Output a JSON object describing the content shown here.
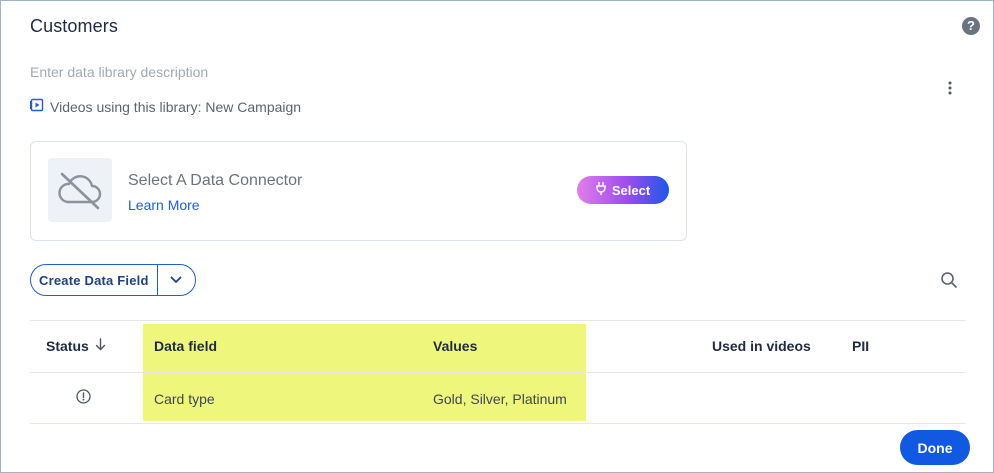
{
  "title": "Customers",
  "description_placeholder": "Enter data library description",
  "videos_text": "Videos using this library: New Campaign",
  "connector": {
    "title": "Select A Data Connector",
    "learn_more": "Learn More",
    "select_label": "Select"
  },
  "create_field_label": "Create Data Field",
  "table": {
    "headers": {
      "status": "Status",
      "data_field": "Data field",
      "values": "Values",
      "used_in_videos": "Used in videos",
      "pii": "PII"
    },
    "rows": [
      {
        "data_field": "Card type",
        "values": "Gold, Silver, Platinum",
        "used_in_videos": "",
        "pii": ""
      }
    ]
  },
  "done_label": "Done",
  "colors": {
    "accent": "#1059e0",
    "highlight": "#eef77c",
    "link": "#1f5fd6"
  },
  "icons": {
    "help": "help-circle-icon",
    "more": "kebab-menu-icon",
    "video": "video-library-icon",
    "cloud_off": "cloud-off-icon",
    "plug": "plug-icon",
    "chevron": "chevron-down-icon",
    "search": "search-icon",
    "sort": "arrow-down-icon",
    "status": "alert-circle-icon"
  }
}
